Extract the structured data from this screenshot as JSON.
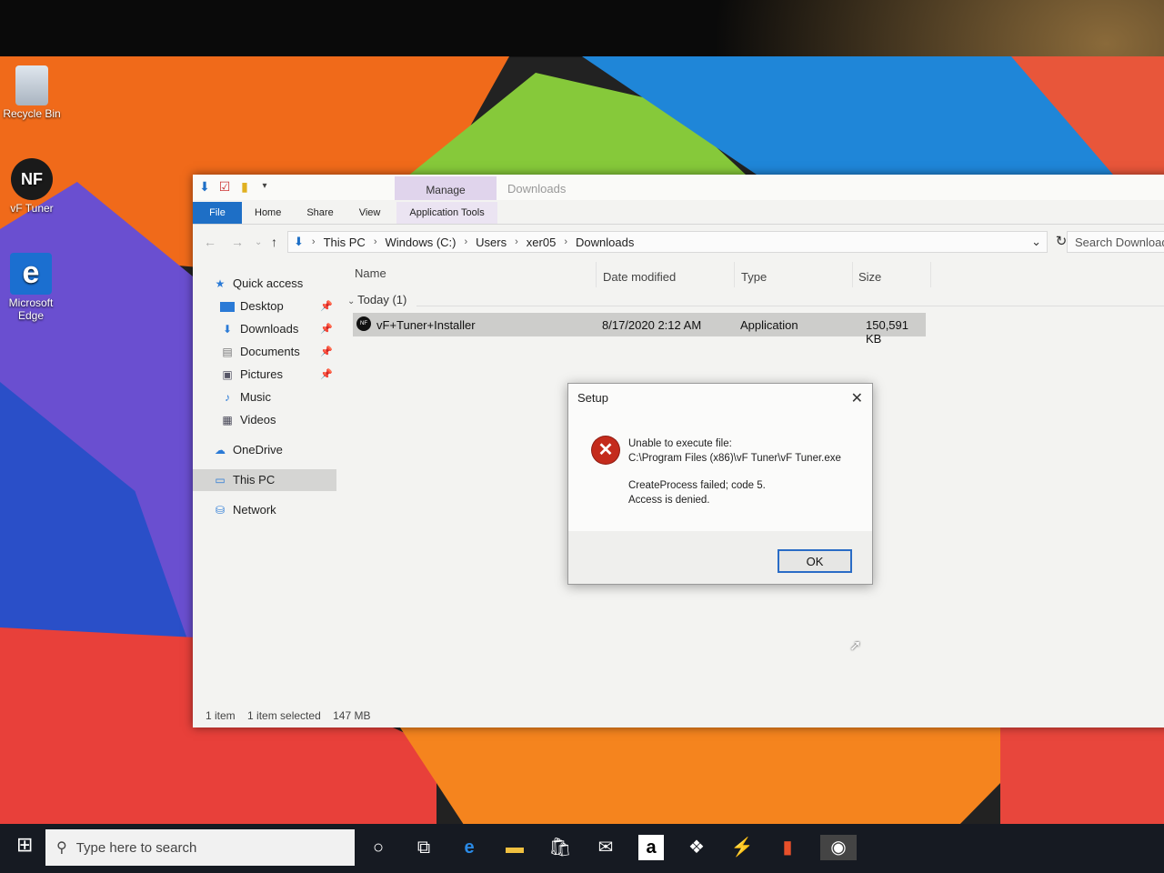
{
  "desktop": {
    "icons": [
      {
        "label": "Recycle Bin",
        "icon": "recycle-bin-icon"
      },
      {
        "label": "vF Tuner",
        "icon": "vf-tuner-icon"
      },
      {
        "label": "Microsoft Edge",
        "icon": "edge-icon"
      }
    ],
    "vf_logo_text": "NF"
  },
  "explorer": {
    "title": "Downloads",
    "manage_tab": "Manage",
    "ribbon_tabs": [
      "File",
      "Home",
      "Share",
      "View",
      "Application Tools"
    ],
    "address": {
      "crumbs": [
        "This PC",
        "Windows (C:)",
        "Users",
        "xer05",
        "Downloads"
      ]
    },
    "search_placeholder": "Search Downloads",
    "nav": [
      {
        "label": "Quick access",
        "icon": "star-icon",
        "pinned": false
      },
      {
        "label": "Desktop",
        "icon": "desktop-icon",
        "pinned": true
      },
      {
        "label": "Downloads",
        "icon": "download-icon",
        "pinned": true
      },
      {
        "label": "Documents",
        "icon": "documents-icon",
        "pinned": true
      },
      {
        "label": "Pictures",
        "icon": "pictures-icon",
        "pinned": true
      },
      {
        "label": "Music",
        "icon": "music-icon",
        "pinned": false
      },
      {
        "label": "Videos",
        "icon": "videos-icon",
        "pinned": false
      },
      {
        "label": "OneDrive",
        "icon": "cloud-icon",
        "pinned": false
      },
      {
        "label": "This PC",
        "icon": "computer-icon",
        "pinned": false,
        "selected": true
      },
      {
        "label": "Network",
        "icon": "network-icon",
        "pinned": false
      }
    ],
    "columns": [
      "Name",
      "Date modified",
      "Type",
      "Size"
    ],
    "group": "Today (1)",
    "files": [
      {
        "name": "vF+Tuner+Installer",
        "date": "8/17/2020 2:12 AM",
        "type": "Application",
        "size": "150,591 KB"
      }
    ],
    "status": {
      "items": "1 item",
      "selected": "1 item selected",
      "size": "147 MB"
    }
  },
  "dialog": {
    "title": "Setup",
    "line1": "Unable to execute file:",
    "line2": "C:\\Program Files (x86)\\vF Tuner\\vF Tuner.exe",
    "line3": "CreateProcess failed; code 5.",
    "line4": "Access is denied.",
    "ok": "OK"
  },
  "taskbar": {
    "search_placeholder": "Type here to search",
    "apps": [
      "cortana-icon",
      "task-view-icon",
      "edge-icon",
      "file-explorer-icon",
      "store-icon",
      "mail-icon",
      "amazon-icon",
      "dropbox-icon",
      "visual-studio-icon",
      "office-icon",
      "vf-tuner-icon"
    ]
  },
  "colors": {
    "accent": "#1e6fc6",
    "manage_tab": "#e0d4ec",
    "error": "#c42b1c"
  }
}
